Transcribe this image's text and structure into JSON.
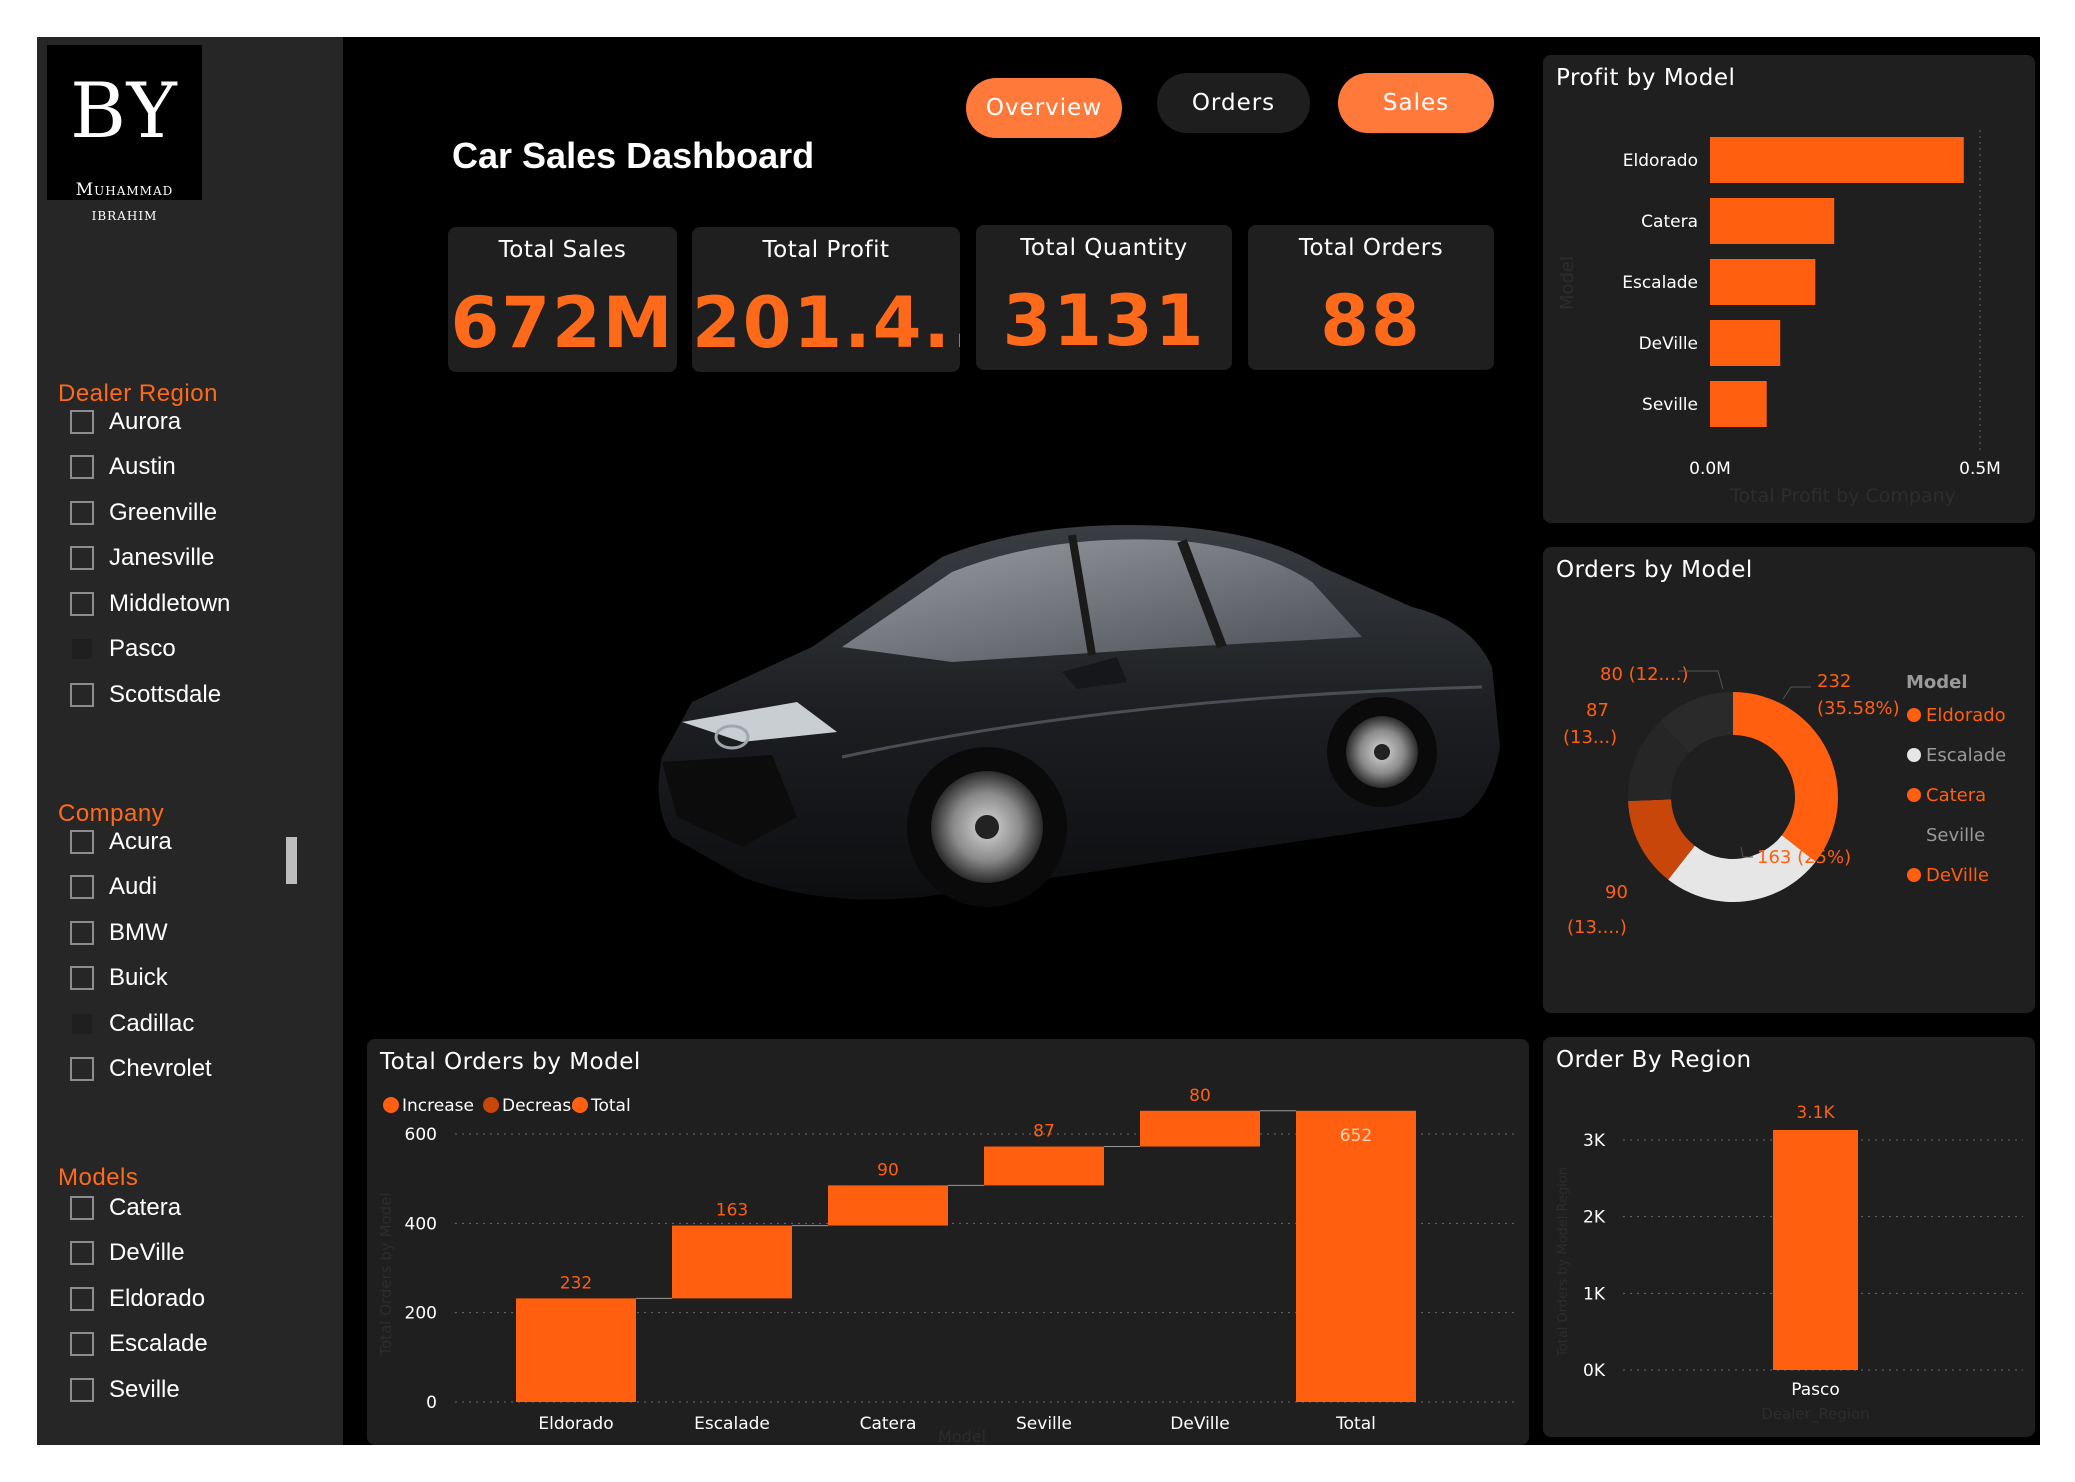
{
  "logo": {
    "monogram": "BY",
    "name_line1": "Muhammad",
    "name_line2": "ibrahim"
  },
  "filters": {
    "dealer_region": {
      "title": "Dealer Region",
      "items": [
        "Aurora",
        "Austin",
        "Greenville",
        "Janesville",
        "Middletown",
        "Pasco",
        "Scottsdale"
      ]
    },
    "company": {
      "title": "Company",
      "items": [
        "Acura",
        "Audi",
        "BMW",
        "Buick",
        "Cadillac",
        "Chevrolet"
      ]
    },
    "models": {
      "title": "Models",
      "items": [
        "Catera",
        "DeVille",
        "Eldorado",
        "Escalade",
        "Seville"
      ]
    }
  },
  "header": {
    "title": "Car Sales Dashboard"
  },
  "nav": {
    "overview": "Overview",
    "orders": "Orders",
    "sales": "Sales"
  },
  "kpis": [
    {
      "label": "Total Sales",
      "value": "672M"
    },
    {
      "label": "Total Profit",
      "value": "201.4..."
    },
    {
      "label": "Total Quantity",
      "value": "3131"
    },
    {
      "label": "Total Orders",
      "value": "88"
    }
  ],
  "colors": {
    "accent": "#ff5f0f",
    "decrease": "#c8460a",
    "panel": "#1f1f1f",
    "sidebar": "#262626",
    "light": "#e6e6e6"
  },
  "chart_data": [
    {
      "type": "bar",
      "title": "Profit by Model",
      "orientation": "horizontal",
      "categories": [
        "Eldorado",
        "Catera",
        "Escalade",
        "DeVille",
        "Seville"
      ],
      "values": [
        0.47,
        0.23,
        0.195,
        0.13,
        0.105
      ],
      "ylabel": "Model",
      "xlabel": "Total Profit by Company",
      "xticks": [
        "0.0M",
        "0.5M"
      ],
      "xlim": [
        0,
        0.5
      ]
    },
    {
      "type": "pie",
      "title": "Orders by Model",
      "legend_title": "Model",
      "legend": [
        "Eldorado",
        "Escalade",
        "Catera",
        "Seville",
        "DeVille"
      ],
      "slices": [
        {
          "name": "Eldorado",
          "value": 232,
          "label": "232",
          "pct": "(35.58%)"
        },
        {
          "name": "Escalade",
          "value": 163,
          "label": "163 (25%)",
          "pct": ""
        },
        {
          "name": "Catera",
          "value": 90,
          "label": "90",
          "pct": "(13....)"
        },
        {
          "name": "Seville",
          "value": 87,
          "label": "87",
          "pct": "(13...)"
        },
        {
          "name": "DeVille",
          "value": 80,
          "label": "80 (12....)",
          "pct": ""
        }
      ]
    },
    {
      "type": "bar",
      "subtype": "waterfall",
      "title": "Total Orders by Model",
      "legend": [
        "Increase",
        "Decrease",
        "Total"
      ],
      "categories": [
        "Eldorado",
        "Escalade",
        "Catera",
        "Seville",
        "DeVille",
        "Total"
      ],
      "values": [
        232,
        163,
        90,
        87,
        80,
        652
      ],
      "labels": [
        "232",
        "163",
        "90",
        "87",
        "80",
        "652"
      ],
      "ylabel": "Total Orders by Model",
      "xlabel": "Model",
      "yticks": [
        "0",
        "200",
        "400",
        "600"
      ],
      "ylim": [
        0,
        680
      ]
    },
    {
      "type": "bar",
      "title": "Order By Region",
      "categories": [
        "Pasco"
      ],
      "values": [
        3131
      ],
      "labels": [
        "3.1K"
      ],
      "ylabel": "Total Orders by Model Region",
      "xlabel": "Dealer_Region",
      "yticks": [
        "0K",
        "1K",
        "2K",
        "3K"
      ],
      "ylim": [
        0,
        3300
      ]
    }
  ]
}
